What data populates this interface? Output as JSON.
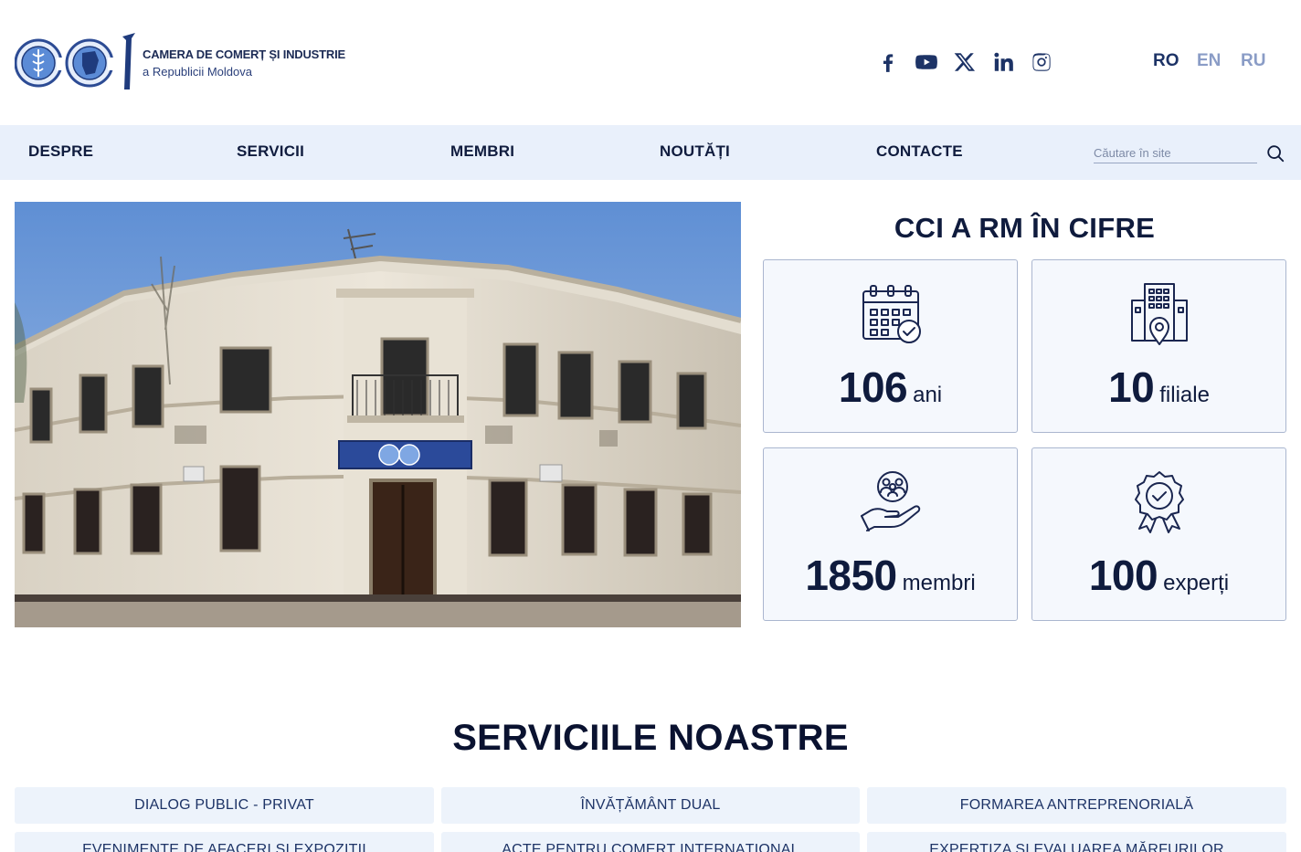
{
  "header": {
    "logo_line1": "CAMERA DE COMERȚ ȘI INDUSTRIE",
    "logo_line2": "a Republicii Moldova",
    "logo_letters": "CCI",
    "social": [
      "facebook-icon",
      "youtube-icon",
      "x-icon",
      "linkedin-icon",
      "instagram-icon"
    ],
    "languages": [
      "RO",
      "EN",
      "RU"
    ],
    "active_language": "RO"
  },
  "nav": {
    "items": [
      "DESPRE",
      "SERVICII",
      "MEMBRI",
      "NOUTĂȚI",
      "CONTACTE"
    ],
    "search_placeholder": "Căutare în site"
  },
  "hero": {
    "sign_left": "CAMERA DE COMERȚ ȘI INDUSTRIE",
    "sign_right": "CHAMBER OF COMMERCE AND INDUSTRY"
  },
  "stats": {
    "title": "CCI A RM ÎN CIFRE",
    "items": [
      {
        "number": "106",
        "unit": "ani",
        "icon": "calendar-icon"
      },
      {
        "number": "10",
        "unit": "filiale",
        "icon": "building-location-icon"
      },
      {
        "number": "1850",
        "unit": "membri",
        "icon": "members-hand-icon"
      },
      {
        "number": "100",
        "unit": "experți",
        "icon": "award-badge-icon"
      }
    ]
  },
  "services": {
    "title": "SERVICIILE NOASTRE",
    "items": [
      "DIALOG PUBLIC - PRIVAT",
      "ÎNVĂȚĂMÂNT DUAL",
      "FORMAREA ANTREPRENORIALĂ",
      "EVENIMENTE DE AFACERI ȘI EXPOZIȚII",
      "ACTE PENTRU COMERȚ INTERNAȚIONAL",
      "EXPERTIZA ȘI EVALUAREA MĂRFURILOR"
    ]
  },
  "colors": {
    "primary": "#1d3366",
    "nav_bg": "#e9f0fb",
    "card_bg": "#f5f8fd",
    "card_border": "#aab6cf",
    "lang_inactive": "#8a9cc6"
  }
}
